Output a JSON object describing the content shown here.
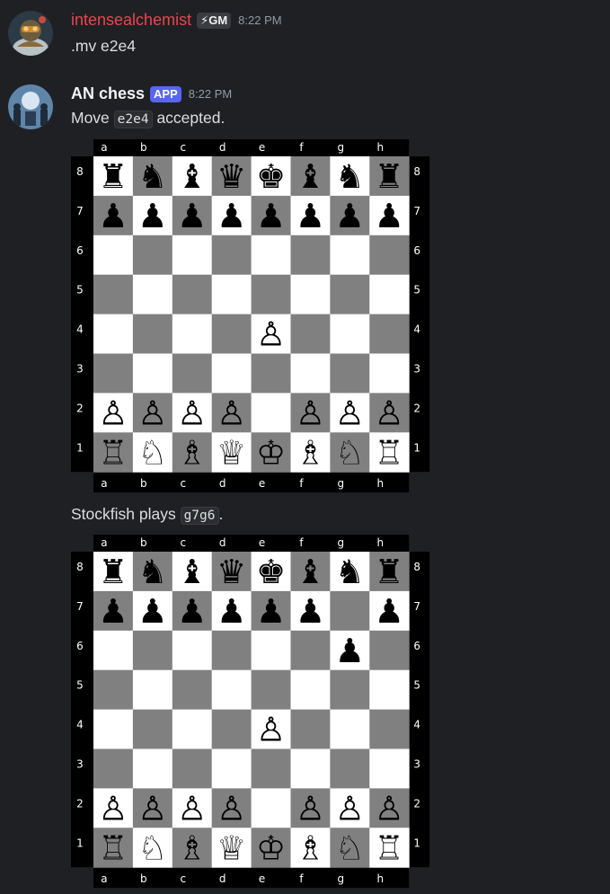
{
  "messages": [
    {
      "username": "intensealchemist",
      "username_color": "#e6474f",
      "tag": "⚡GM",
      "time": "8:22 PM",
      "text": ".mv e2e4"
    },
    {
      "username": "AN chess",
      "username_color": "#f2f3f5",
      "tag": "APP",
      "time": "8:22 PM",
      "text_before": "Move ",
      "code": "e2e4",
      "text_after": " accepted."
    },
    {
      "text_before": "Stockfish plays ",
      "code": "g7g6",
      "text_after": "."
    }
  ],
  "board": {
    "files": [
      "a",
      "b",
      "c",
      "d",
      "e",
      "f",
      "g",
      "h"
    ],
    "ranks": [
      "8",
      "7",
      "6",
      "5",
      "4",
      "3",
      "2",
      "1"
    ],
    "light_square": "#ffffff",
    "dark_square": "#808080",
    "position_after_e2e4": [
      "rnbqkbnr",
      "pppppppp",
      "........",
      "........",
      "....P...",
      "........",
      "PPPP.PPP",
      "RNBQKBNR"
    ],
    "position_after_g7g6": [
      "rnbqkbnr",
      "pppppp.p",
      "......p.",
      "........",
      "....P...",
      "........",
      "PPPP.PPP",
      "RNBQKBNR"
    ]
  }
}
